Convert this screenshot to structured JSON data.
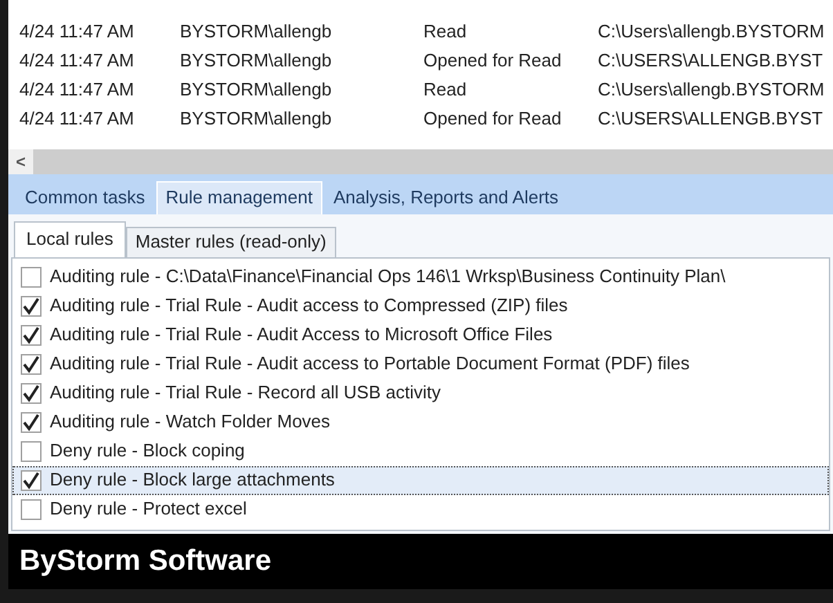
{
  "log_table": {
    "rows": [
      {
        "time": "4/24 11:47 AM",
        "user": "BYSTORM\\allengb",
        "action": "Read",
        "path": "C:\\Users\\allengb.BYSTORM"
      },
      {
        "time": "4/24 11:47 AM",
        "user": "BYSTORM\\allengb",
        "action": "Opened for Read",
        "path": "C:\\USERS\\ALLENGB.BYST"
      },
      {
        "time": "4/24 11:47 AM",
        "user": "BYSTORM\\allengb",
        "action": "Read",
        "path": "C:\\Users\\allengb.BYSTORM"
      },
      {
        "time": "4/24 11:47 AM",
        "user": "BYSTORM\\allengb",
        "action": "Opened for Read",
        "path": "C:\\USERS\\ALLENGB.BYST"
      }
    ],
    "scroll_left": "<"
  },
  "tabs": [
    {
      "label": "Common tasks",
      "selected": false
    },
    {
      "label": "Rule management",
      "selected": true
    },
    {
      "label": "Analysis, Reports and Alerts",
      "selected": false
    }
  ],
  "subtabs": [
    {
      "label": "Local rules",
      "selected": true
    },
    {
      "label": "Master rules (read-only)",
      "selected": false
    }
  ],
  "rules": [
    {
      "label": "Auditing rule - C:\\Data\\Finance\\Financial Ops 146\\1 Wrksp\\Business Continuity Plan\\",
      "checked": false,
      "selected": false
    },
    {
      "label": "Auditing rule - Trial Rule - Audit access to Compressed (ZIP) files",
      "checked": true,
      "selected": false
    },
    {
      "label": "Auditing rule - Trial Rule - Audit Access to Microsoft Office Files",
      "checked": true,
      "selected": false
    },
    {
      "label": "Auditing rule - Trial Rule - Audit access to Portable Document Format (PDF) files",
      "checked": true,
      "selected": false
    },
    {
      "label": "Auditing rule - Trial Rule - Record all USB activity",
      "checked": true,
      "selected": false
    },
    {
      "label": "Auditing rule - Watch Folder Moves",
      "checked": true,
      "selected": false
    },
    {
      "label": "Deny rule - Block coping",
      "checked": false,
      "selected": false
    },
    {
      "label": "Deny rule - Block large attachments",
      "checked": true,
      "selected": true
    },
    {
      "label": "Deny rule - Protect excel",
      "checked": false,
      "selected": false
    }
  ],
  "footer": {
    "title": "ByStorm Software"
  }
}
